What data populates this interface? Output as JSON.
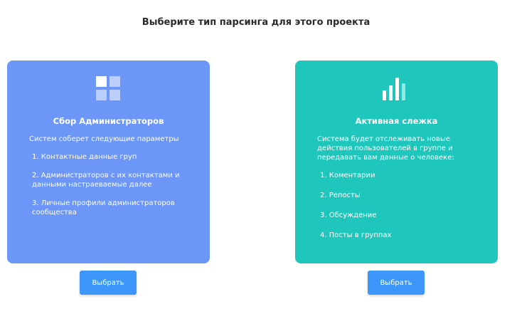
{
  "header": {
    "title": "Выберите тип парсинга для этого проекта"
  },
  "cards": [
    {
      "icon": "grid-icon",
      "title": "Сбор Администраторов",
      "intro": "Систем соберет следующие параметры",
      "items": [
        "1. Контактные данные груп",
        "2. Администраторов с их контактами и данными настраеваемые далее",
        "3. Личные профили администраторов сообщества"
      ],
      "button_label": "Выбрать",
      "color": "#6c96f8"
    },
    {
      "icon": "bar-chart-icon",
      "title": "Активная слежка",
      "intro": "Система будет отслеживать новые действия пользователей в группе и передавать вам данные о человеке:",
      "items": [
        "1. Коментарии",
        "2. Репосты",
        "3. Обсуждение",
        "4. Посты в группах"
      ],
      "button_label": "Выбрать",
      "color": "#1ec6bb"
    }
  ],
  "accent_button_color": "#3d97fb"
}
